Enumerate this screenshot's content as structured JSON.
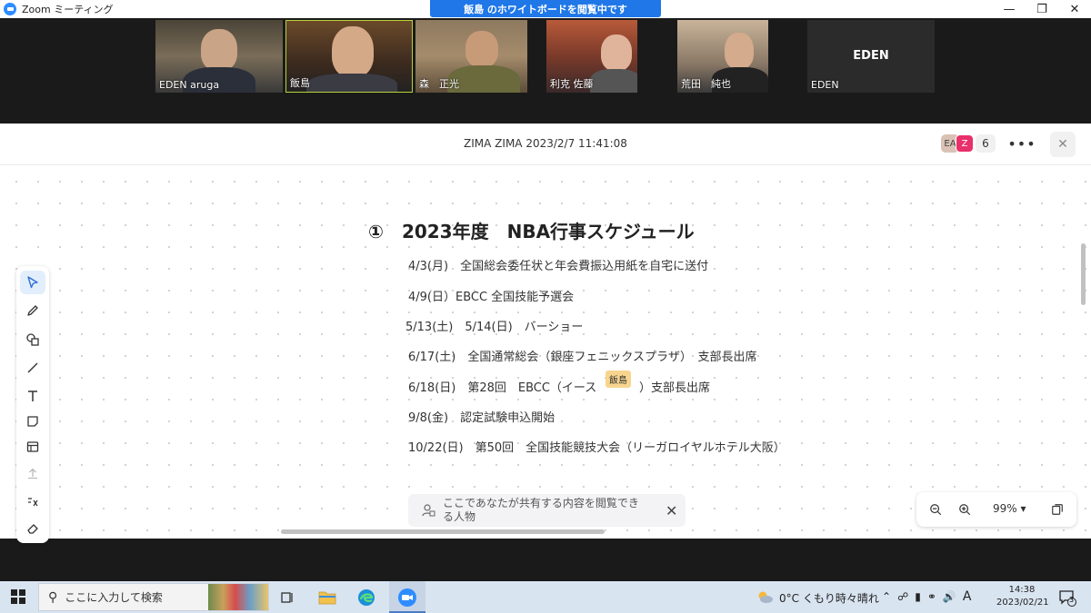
{
  "window": {
    "title": "Zoom ミーティング",
    "viewing_banner": "飯島 のホワイトボードを閲覧中です"
  },
  "participants": [
    {
      "name": "EDEN aruga"
    },
    {
      "name": "飯島"
    },
    {
      "name": "森　正光"
    },
    {
      "name": "利克 佐藤"
    },
    {
      "name": "荒田　純也"
    },
    {
      "name": "EDEN",
      "label": "EDEN"
    }
  ],
  "whiteboard": {
    "title": "ZIMA ZIMA 2023/2/7 11:41:08",
    "avatars": [
      "EA",
      "Z"
    ],
    "participant_count": "6",
    "heading_num": "①",
    "heading_text": "2023年度　NBA行事スケジュール",
    "lines": [
      "4/3(月)　全国総会委任状と年会費振込用紙を自宅に送付",
      "4/9(日）EBCC 全国技能予選会",
      "5/13(土)　5/14(日)　バーショー",
      "6/17(土)　全国通常総会（銀座フェニックスプラザ）　支部長出席",
      "6/18(日)　第28回　EBCC（イース",
      "）支部長出席",
      "9/8(金)　認定試験申込開始",
      "10/22(日)　第50回　全国技能競技大会（リーガロイヤルホテル大阪）"
    ],
    "cursor_label": "飯島",
    "tooltip_text": "ここであなたが共有する内容を閲覧できる人物",
    "zoom_level": "99%"
  },
  "taskbar": {
    "search_placeholder": "ここに入力して検索",
    "weather": "0°C  くもり時々晴れ",
    "ime": "A",
    "time": "14:38",
    "date": "2023/02/21",
    "notifications": "3"
  },
  "colors": {
    "zoom_blue": "#2d8cff",
    "banner_blue": "#1f77e8",
    "active_speaker": "#b6d43a",
    "avatar_z": "#e8306b"
  }
}
